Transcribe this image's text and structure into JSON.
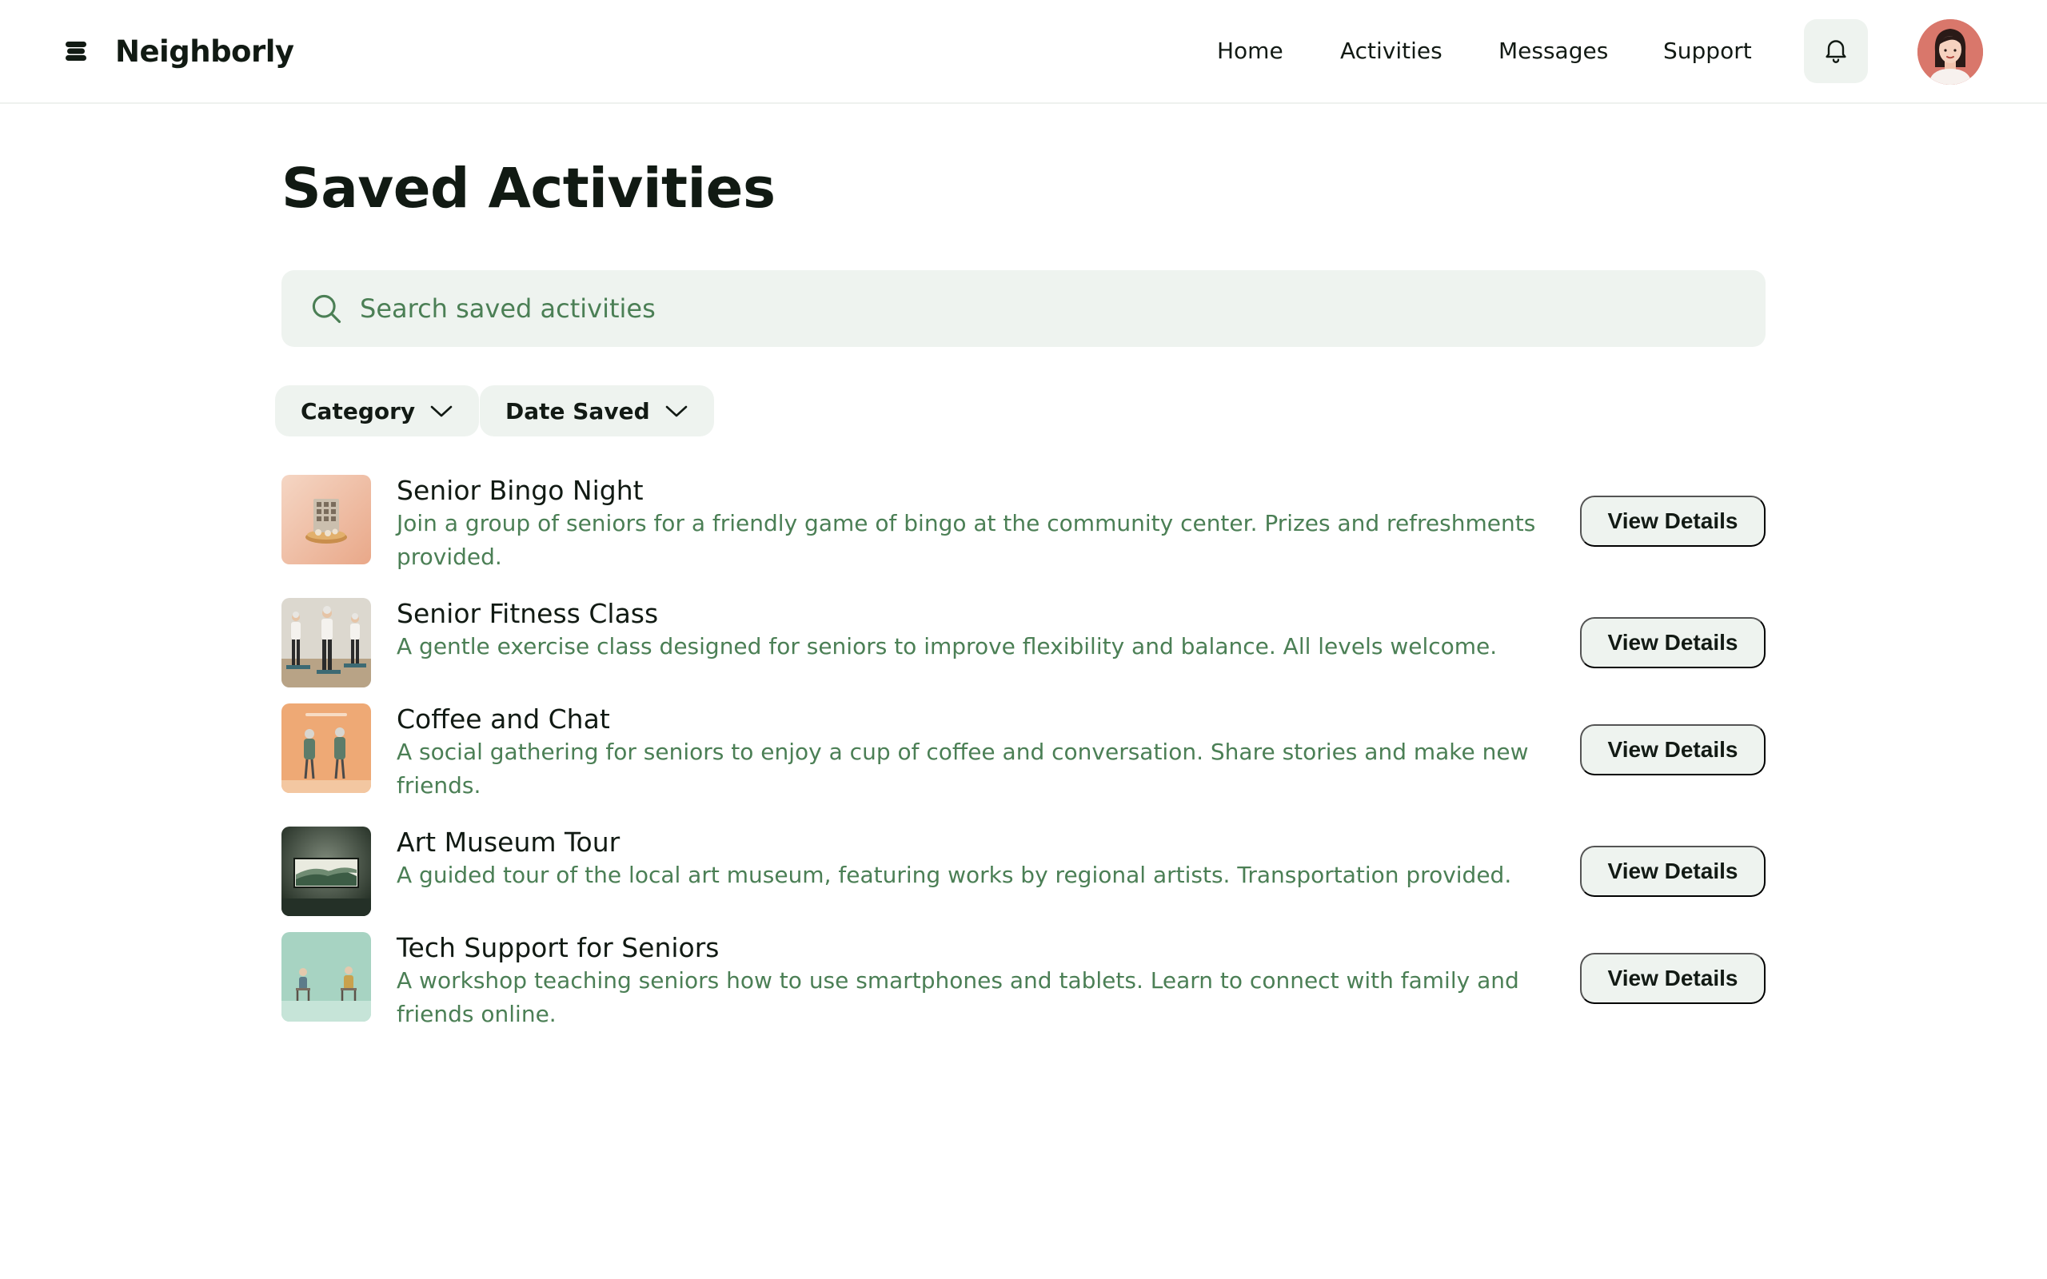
{
  "header": {
    "brand": "Neighborly",
    "nav": [
      {
        "label": "Home"
      },
      {
        "label": "Activities"
      },
      {
        "label": "Messages"
      },
      {
        "label": "Support"
      }
    ]
  },
  "main": {
    "title": "Saved Activities",
    "search": {
      "placeholder": "Search saved activities",
      "value": ""
    },
    "filters": [
      {
        "label": "Category"
      },
      {
        "label": "Date Saved"
      }
    ],
    "activities": [
      {
        "title": "Senior Bingo Night",
        "description": "Join a group of seniors for a friendly game of bingo at the community center. Prizes and refreshments provided.",
        "button": "View Details"
      },
      {
        "title": "Senior Fitness Class",
        "description": "A gentle exercise class designed for seniors to improve flexibility and balance. All levels welcome.",
        "button": "View Details"
      },
      {
        "title": "Coffee and Chat",
        "description": "A social gathering for seniors to enjoy a cup of coffee and conversation. Share stories and make new friends.",
        "button": "View Details"
      },
      {
        "title": "Art Museum Tour",
        "description": "A guided tour of the local art museum, featuring works by regional artists. Transportation provided.",
        "button": "View Details"
      },
      {
        "title": "Tech Support for Seniors",
        "description": "A workshop teaching seniors how to use smartphones and tablets. Learn to connect with family and friends online.",
        "button": "View Details"
      }
    ]
  },
  "colors": {
    "accent_text": "#4b7f55",
    "surface": "#eef3ef",
    "ink": "#121a14"
  },
  "icons": [
    "logo-icon",
    "bell-icon",
    "search-icon",
    "chevron-down-icon"
  ]
}
